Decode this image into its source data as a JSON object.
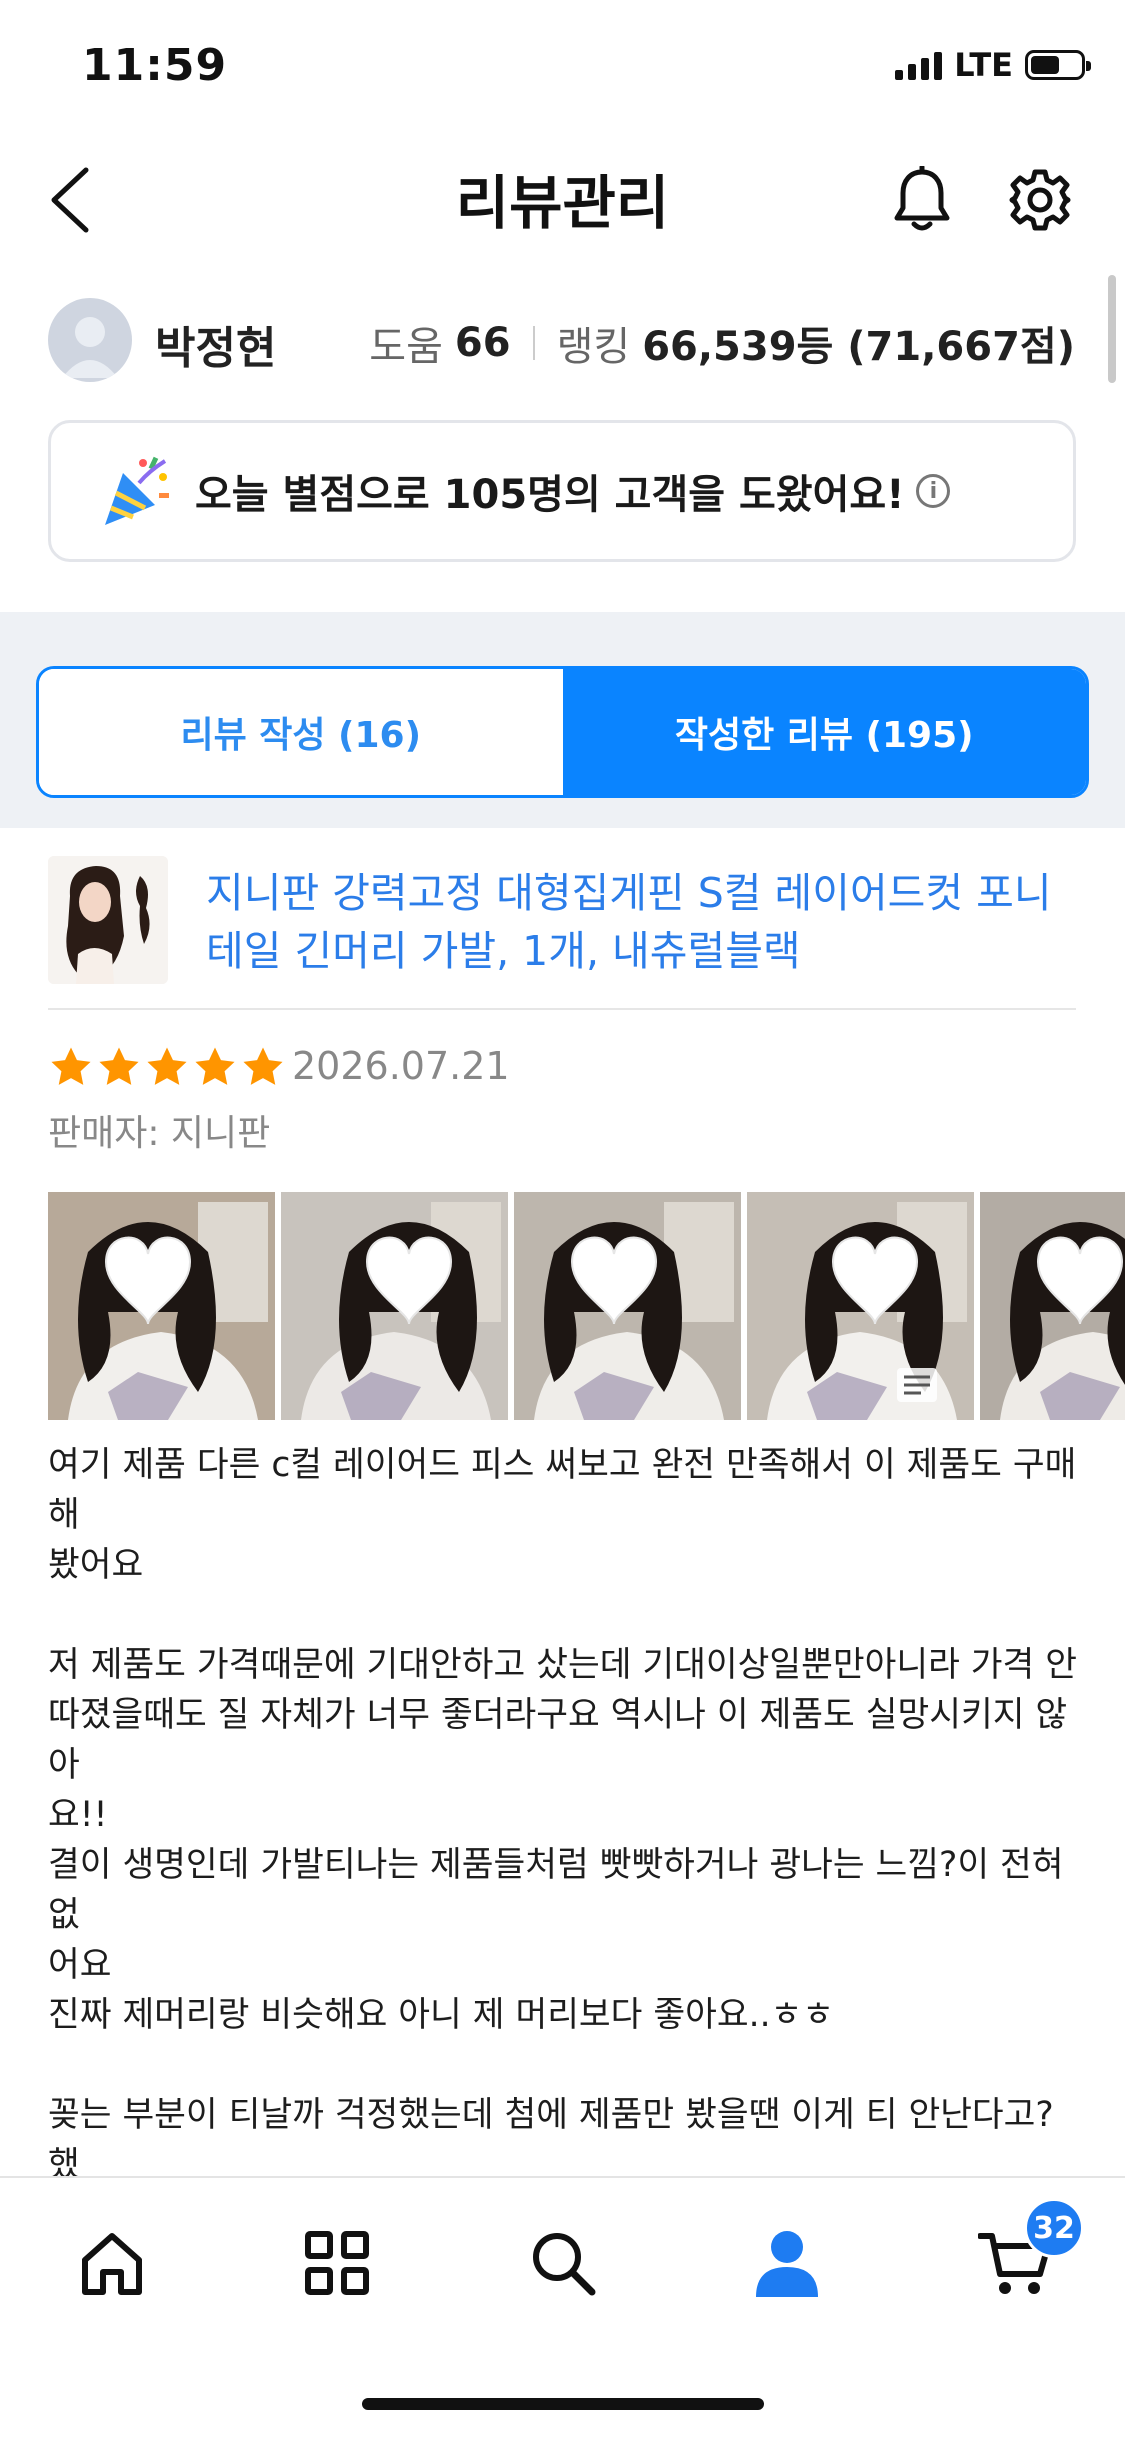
{
  "status_bar": {
    "time": "11:59",
    "network": "LTE"
  },
  "header": {
    "title": "리뷰관리",
    "back_icon": "chevron-left-icon",
    "bell_icon": "bell-icon",
    "settings_icon": "gear-icon"
  },
  "profile": {
    "name": "박정현",
    "help_label": "도움",
    "help_value": "66",
    "ranking_label": "랭킹",
    "ranking_value": "66,539등 (71,667점)"
  },
  "banner": {
    "text": "오늘 별점으로 105명의 고객을 도왔어요!",
    "icon": "party-popper-icon",
    "info_icon": "info-icon"
  },
  "tabs": [
    {
      "label": "리뷰 작성 (16)",
      "active": false
    },
    {
      "label": "작성한 리뷰 (195)",
      "active": true
    }
  ],
  "review": {
    "product_title": "지니판 강력고정 대형집게핀 S컬 레이어드컷 포니테일 긴머리 가발, 1개, 내츄럴블랙",
    "rating": 5,
    "date": "2026.07.21",
    "seller": "판매자: 지니판",
    "photo_count_visible": 5,
    "body": "여기 제품 다른 c컬 레이어드 피스 써보고 완전 만족해서 이 제품도 구매해\n봤어요\n\n저 제품도 가격때문에 기대안하고 샀는데 기대이상일뿐만아니라 가격 안\n따졌을때도 질 자체가 너무 좋더라구요 역시나 이 제품도 실망시키지 않아\n요!!\n결이 생명인데 가발티나는 제품들처럼 빳빳하거나 광나는 느낌?이 전혀 없\n어요\n진짜 제머리랑 비슷해요 아니 제 머리보다 좋아요..ㅎㅎ\n\n꽂는 부분이 티날까 걱정했는데 첨에 제품만 봤을땐 이게 티 안난다고? 했\n는데 엄머나 티안나요ㅋㅋㅋㅋㅋ\n집게라서 쓰기도 왕편한데 말이에요 그냥 1초면 가능!! 그런데 집게가 크기\n가있어서 고정력도 좋다니 진짜 짱.."
  },
  "bottom_nav": {
    "items": [
      "home-icon",
      "categories-icon",
      "search-icon",
      "my-account-icon",
      "cart-icon"
    ],
    "active": "my-account-icon",
    "cart_badge": "32"
  },
  "colors": {
    "accent": "#0a84ff",
    "link": "#2b7de9",
    "star": "#ff9500",
    "tab_band": "#eef1f5"
  }
}
